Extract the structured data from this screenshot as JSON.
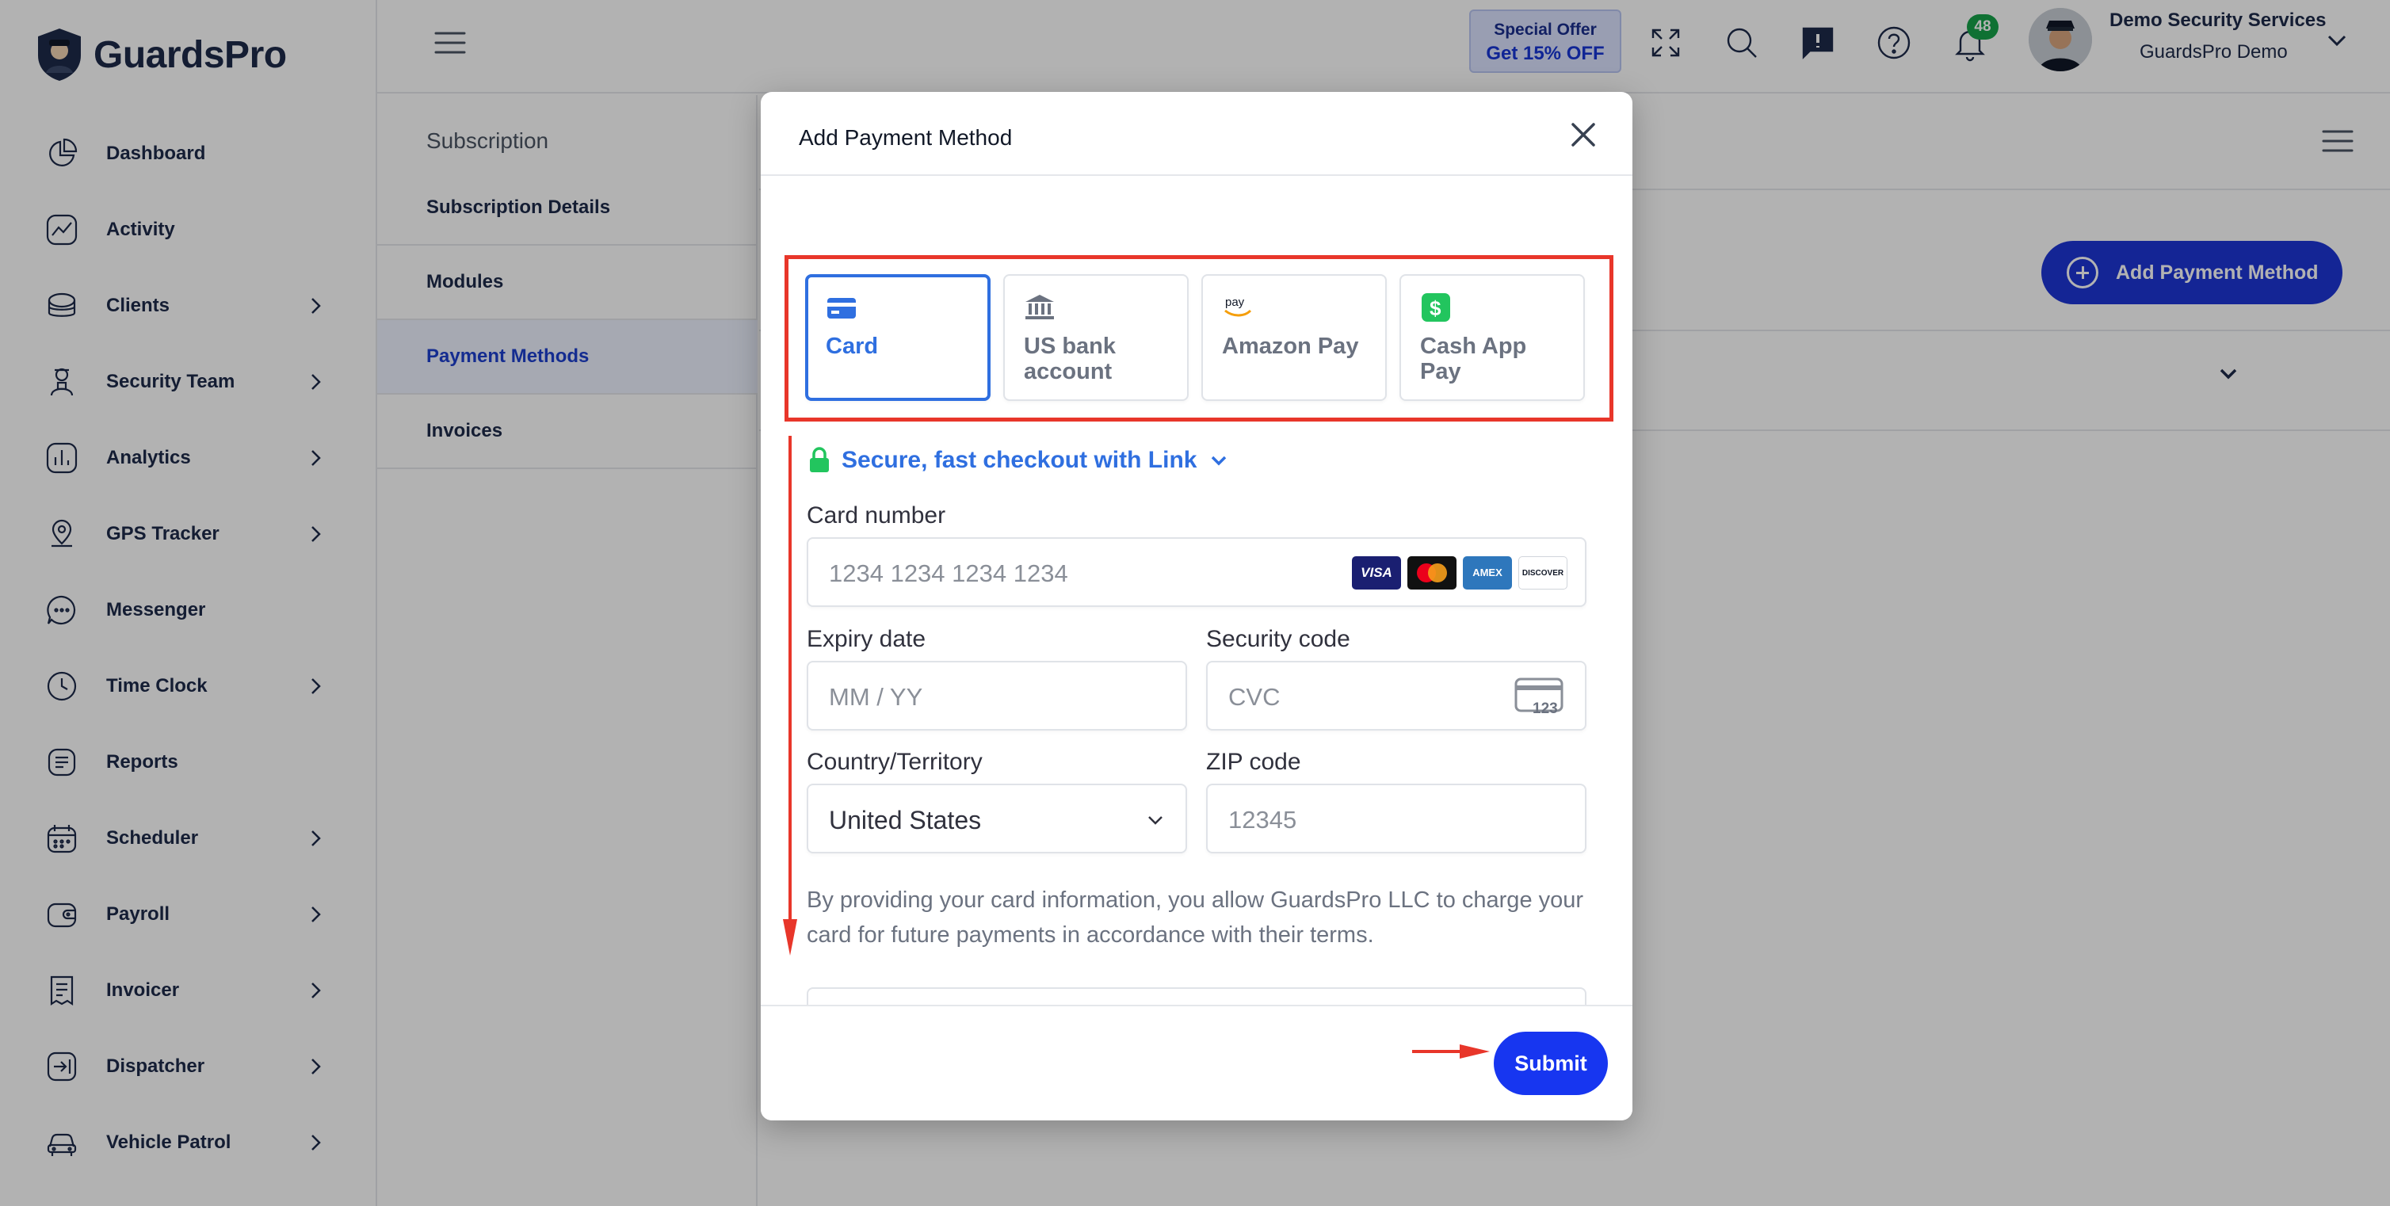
{
  "brand": {
    "name": "GuardsPro"
  },
  "sidebar": {
    "items": [
      {
        "label": "Dashboard",
        "icon": "pie-chart-icon",
        "has_chevron": false
      },
      {
        "label": "Activity",
        "icon": "activity-icon",
        "has_chevron": false
      },
      {
        "label": "Clients",
        "icon": "clients-icon",
        "has_chevron": true
      },
      {
        "label": "Security Team",
        "icon": "security-team-icon",
        "has_chevron": true
      },
      {
        "label": "Analytics",
        "icon": "analytics-icon",
        "has_chevron": true
      },
      {
        "label": "GPS Tracker",
        "icon": "map-pin-icon",
        "has_chevron": true
      },
      {
        "label": "Messenger",
        "icon": "chat-icon",
        "has_chevron": false
      },
      {
        "label": "Time Clock",
        "icon": "clock-icon",
        "has_chevron": true
      },
      {
        "label": "Reports",
        "icon": "reports-icon",
        "has_chevron": false
      },
      {
        "label": "Scheduler",
        "icon": "calendar-icon",
        "has_chevron": true
      },
      {
        "label": "Payroll",
        "icon": "wallet-icon",
        "has_chevron": true
      },
      {
        "label": "Invoicer",
        "icon": "receipt-icon",
        "has_chevron": true
      },
      {
        "label": "Dispatcher",
        "icon": "dispatch-icon",
        "has_chevron": true
      },
      {
        "label": "Vehicle Patrol",
        "icon": "car-icon",
        "has_chevron": true
      }
    ]
  },
  "topbar": {
    "offer_line1": "Special Offer",
    "offer_line2": "Get 15% OFF",
    "notification_count": "48",
    "user_name": "Demo Security Services",
    "user_org": "GuardsPro Demo"
  },
  "submenu": {
    "title": "Subscription",
    "items": [
      "Subscription Details",
      "Modules",
      "Payment Methods",
      "Invoices"
    ],
    "active_index": 2
  },
  "main": {
    "add_button_label": "Add Payment Method"
  },
  "modal": {
    "title": "Add Payment Method",
    "tabs": [
      {
        "label": "Card",
        "icon": "card-icon"
      },
      {
        "label": "US bank account",
        "icon": "bank-icon"
      },
      {
        "label": "Amazon Pay",
        "icon": "amazon-pay-icon",
        "icon_text": "pay"
      },
      {
        "label": "Cash App Pay",
        "icon": "cash-app-icon"
      }
    ],
    "active_tab": 0,
    "link_label": "Secure, fast checkout with Link",
    "card_number": {
      "label": "Card number",
      "placeholder": "1234 1234 1234 1234"
    },
    "card_brands": [
      "VISA",
      "MC",
      "AMEX",
      "DISCOVER"
    ],
    "expiry": {
      "label": "Expiry date",
      "placeholder": "MM / YY"
    },
    "cvc": {
      "label": "Security code",
      "placeholder": "CVC",
      "icon_text": "123"
    },
    "country": {
      "label": "Country/Territory",
      "value": "United States"
    },
    "zip": {
      "label": "ZIP code",
      "placeholder": "12345"
    },
    "disclaimer": "By providing your card information, you allow GuardsPro LLC to charge your card for future payments in accordance with their terms.",
    "submit_label": "Submit"
  },
  "colors": {
    "accent": "#2f6fe0",
    "primary_button": "#1736f0",
    "annotation": "#e8362a",
    "badge": "#16a34a",
    "nav_text": "#1e2a4a"
  }
}
